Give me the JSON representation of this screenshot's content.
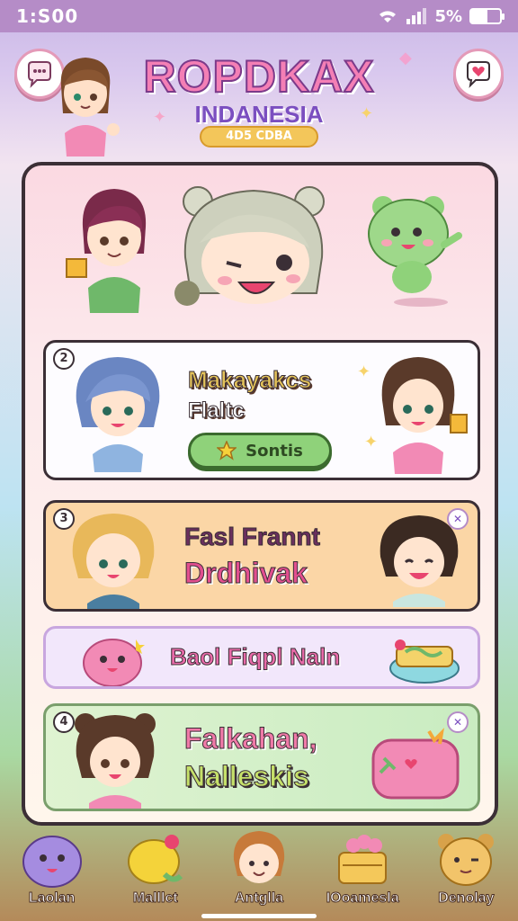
{
  "status_bar": {
    "time": "1:S00",
    "battery_text": "5%",
    "battery_level": 0.55
  },
  "header": {
    "title": "ROPDKAX",
    "subtitle": "INDANESIA",
    "badge": "4D5 CDBA",
    "left_button_icon": "chat-bubble-icon",
    "right_button_icon": "heart-message-icon"
  },
  "cards": [
    {
      "number": "2",
      "line1": "Makayakcs",
      "line2": "Flaltc",
      "button_label": "Sontis",
      "button_icon": "star-icon"
    },
    {
      "number": "3",
      "line1": "Fasl Frannt",
      "line2": "Drdhivak",
      "corner_icon": "share-icon"
    },
    {
      "line": "Baol Fiqpl Naln"
    },
    {
      "number": "4",
      "line1": "Falkahan,",
      "line2": "Nalleskis",
      "corner_icon": "share-icon"
    }
  ],
  "bottom_nav": [
    {
      "label": "Laolan",
      "icon": "purple-blob-icon"
    },
    {
      "label": "Malllct",
      "icon": "lemon-icon"
    },
    {
      "label": "Antglla",
      "icon": "girl-avatar-icon"
    },
    {
      "label": "IOoamesla",
      "icon": "gift-basket-icon"
    },
    {
      "label": "Denolay",
      "icon": "bear-avatar-icon"
    }
  ],
  "colors": {
    "accent_pink": "#f47fb5",
    "accent_purple": "#7b4fc0",
    "outline": "#3b2f36",
    "status_bar": "#b58cc7"
  }
}
